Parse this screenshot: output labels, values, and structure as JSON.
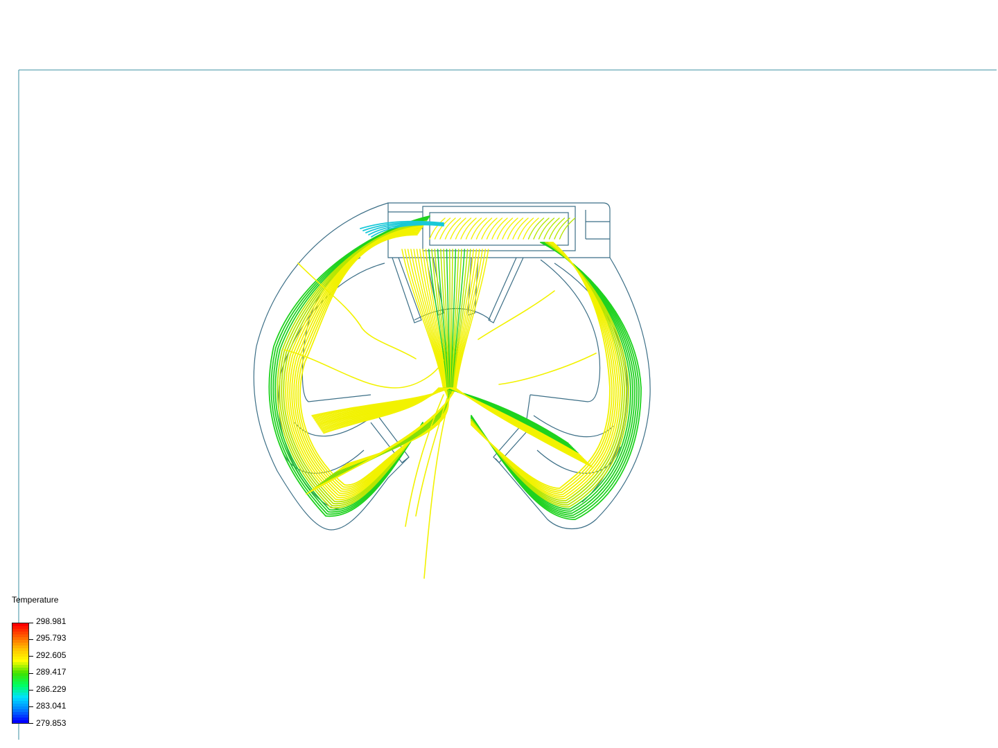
{
  "legend": {
    "title": "Temperature",
    "ticks": [
      "298.981",
      "295.793",
      "292.605",
      "289.417",
      "286.229",
      "283.041",
      "279.853"
    ],
    "colormap": [
      "#0000ff",
      "#0080ff",
      "#00e0ff",
      "#00ff60",
      "#40e000",
      "#ffff00",
      "#ffc000",
      "#ff6000",
      "#ff0000"
    ]
  },
  "colors": {
    "geometry_outline": "#3b6e86",
    "streamline_primary": "#f2f200",
    "streamline_secondary": "#b7e600",
    "streamline_cool": "#1fd21f",
    "streamline_cold": "#18c8d8"
  }
}
